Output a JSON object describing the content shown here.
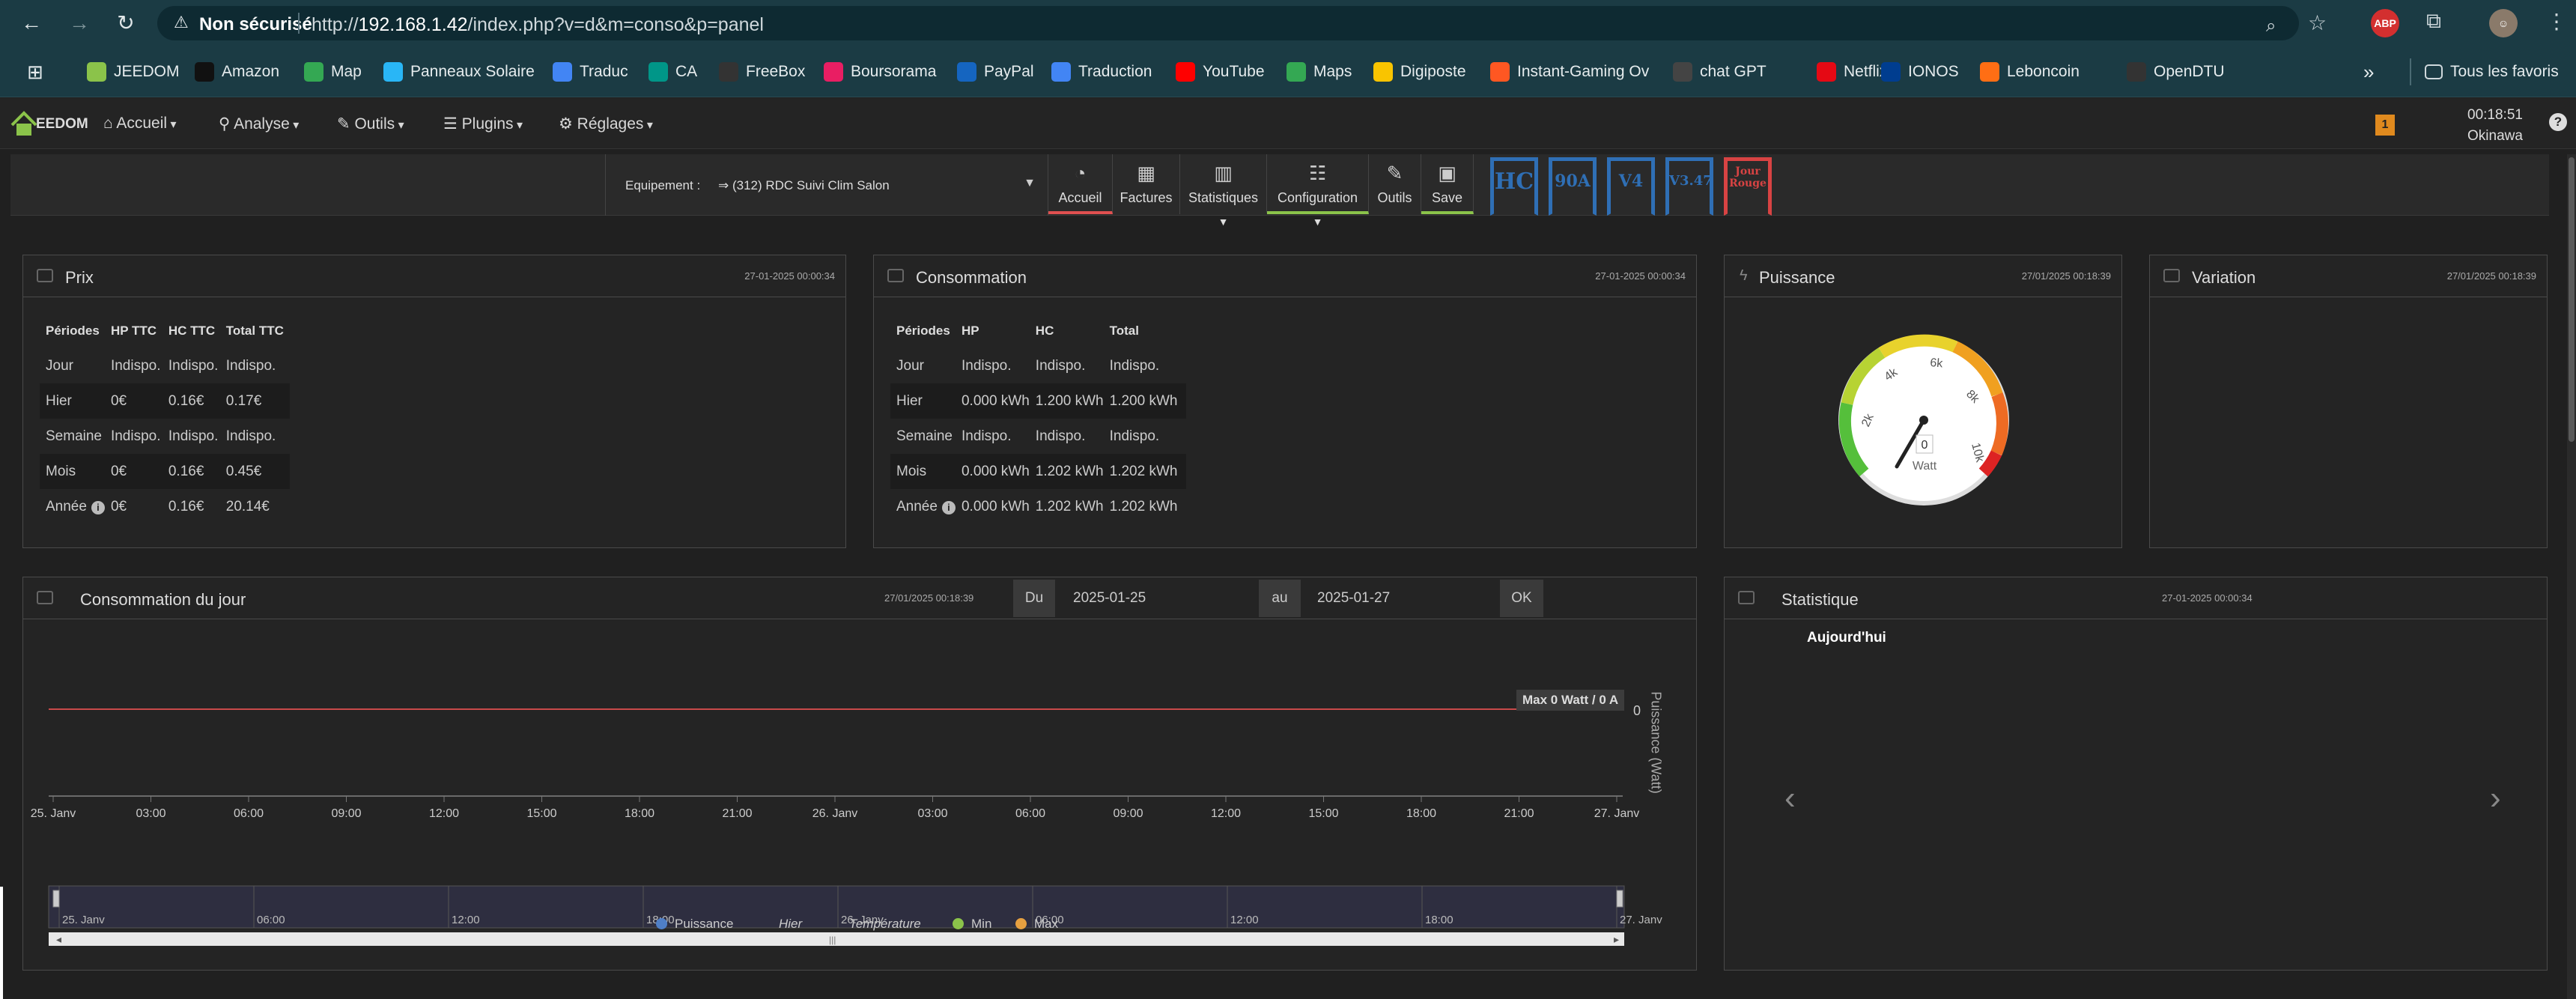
{
  "browser": {
    "security_label": "Non sécurisé",
    "url_prefix": "http://",
    "url_host": "192.168.1.42",
    "url_path": "/index.php?v=d&m=conso&p=panel",
    "ext_abp": "ABP"
  },
  "bookmarks": [
    {
      "label": "JEEDOM",
      "color": "#8bc34a"
    },
    {
      "label": "Amazon",
      "color": "#111111"
    },
    {
      "label": "Map",
      "color": "#34a853"
    },
    {
      "label": "Panneaux Solaire",
      "color": "#29b6f6"
    },
    {
      "label": "Traduc",
      "color": "#4285f4"
    },
    {
      "label": "CA",
      "color": "#009688"
    },
    {
      "label": "FreeBox",
      "color": "#333333"
    },
    {
      "label": "Boursorama",
      "color": "#e91e63"
    },
    {
      "label": "PayPal",
      "color": "#1565c0"
    },
    {
      "label": "Traduction",
      "color": "#4285f4"
    },
    {
      "label": "YouTube",
      "color": "#ff0000"
    },
    {
      "label": "Maps",
      "color": "#34a853"
    },
    {
      "label": "Digiposte",
      "color": "#f9c400"
    },
    {
      "label": "Instant-Gaming Ov",
      "color": "#ff5722"
    },
    {
      "label": "chat GPT",
      "color": "#444444"
    },
    {
      "label": "Netflix",
      "color": "#e50914"
    },
    {
      "label": "IONOS",
      "color": "#003d8f"
    },
    {
      "label": "Leboncoin",
      "color": "#ff6e14"
    },
    {
      "label": "OpenDTU",
      "color": "#333333"
    }
  ],
  "bookmarks_more": "»",
  "bookmarks_all": "Tous les favoris",
  "nav": {
    "logo": "EEDOM",
    "menu": [
      "Accueil",
      "Analyse",
      "Outils",
      "Plugins",
      "Réglages"
    ],
    "badge": "1",
    "time": "00:18:51",
    "location": "Okinawa",
    "help": "?"
  },
  "toolbar": {
    "equip_label": "Equipement :",
    "equip_value": "⇒ (312) RDC Suivi Clim Salon",
    "buttons": [
      "Accueil",
      "Factures",
      "Statistiques",
      "Configuration",
      "Outils",
      "Save"
    ],
    "ribbons": [
      "HC",
      "90A",
      "V4",
      "V3.47",
      "Jour Rouge"
    ],
    "colors": {
      "accueil": "#e05050",
      "configuration": "#8bc34a",
      "save": "#8bc34a",
      "ribbon_blue": "#2f6fb5",
      "ribbon_red": "#d84343"
    }
  },
  "prix": {
    "title": "Prix",
    "date": "27-01-2025 00:00:34",
    "headers": [
      "Périodes",
      "HP TTC",
      "HC TTC",
      "Total TTC"
    ],
    "rows": [
      [
        "Jour",
        "Indispo.",
        "Indispo.",
        "Indispo."
      ],
      [
        "Hier",
        "0€",
        "0.16€",
        "0.17€"
      ],
      [
        "Semaine",
        "Indispo.",
        "Indispo.",
        "Indispo."
      ],
      [
        "Mois",
        "0€",
        "0.16€",
        "0.45€"
      ],
      [
        "Année",
        "0€",
        "0.16€",
        "20.14€"
      ]
    ]
  },
  "consommation": {
    "title": "Consommation",
    "date": "27-01-2025 00:00:34",
    "headers": [
      "Périodes",
      "HP",
      "HC",
      "Total"
    ],
    "rows": [
      [
        "Jour",
        "Indispo.",
        "Indispo.",
        "Indispo."
      ],
      [
        "Hier",
        "0.000 kWh",
        "1.200 kWh",
        "1.200 kWh"
      ],
      [
        "Semaine",
        "Indispo.",
        "Indispo.",
        "Indispo."
      ],
      [
        "Mois",
        "0.000 kWh",
        "1.202 kWh",
        "1.202 kWh"
      ],
      [
        "Année",
        "0.000 kWh",
        "1.202 kWh",
        "1.202 kWh"
      ]
    ]
  },
  "puissance": {
    "title": "Puissance",
    "date": "27/01/2025 00:18:39",
    "value": "0",
    "unit": "Watt",
    "gauge_labels": [
      "2k",
      "4k",
      "6k",
      "8k",
      "10k"
    ]
  },
  "variation": {
    "title": "Variation",
    "date": "27/01/2025 00:18:39"
  },
  "conso_jour": {
    "title": "Consommation du jour",
    "date": "27/01/2025 00:18:39",
    "du_label": "Du",
    "du_value": "2025-01-25",
    "au_label": "au",
    "au_value": "2025-01-27",
    "ok_label": "OK"
  },
  "statistique": {
    "title": "Statistique",
    "date": "27-01-2025 00:00:34",
    "subtitle": "Aujourd'hui",
    "prev": "‹",
    "next": "›"
  },
  "chart_data": {
    "type": "line",
    "title": "",
    "ylabel": "Puissance (Watt)",
    "x_ticks": [
      "25. Janv",
      "03:00",
      "06:00",
      "09:00",
      "12:00",
      "15:00",
      "18:00",
      "21:00",
      "26. Janv",
      "03:00",
      "06:00",
      "09:00",
      "12:00",
      "15:00",
      "18:00",
      "21:00",
      "27. Janv"
    ],
    "navigator_ticks": [
      "25. Janv",
      "06:00",
      "12:00",
      "18:00",
      "26. Janv",
      "06:00",
      "12:00",
      "18:00",
      "27. Janv"
    ],
    "y_tick": "0",
    "annotation": "Max 0 Watt / 0 A",
    "series": [
      {
        "name": "Puissance",
        "color": "#4f7fc7",
        "values": [
          0,
          0
        ]
      },
      {
        "name": "Hier",
        "color": "",
        "values": []
      },
      {
        "name": "Température",
        "color": "",
        "values": []
      },
      {
        "name": "Min",
        "color": "#8bc34a",
        "values": []
      },
      {
        "name": "Max",
        "color": "#e6a040",
        "values": []
      }
    ],
    "line_color": "#c84a4a"
  }
}
